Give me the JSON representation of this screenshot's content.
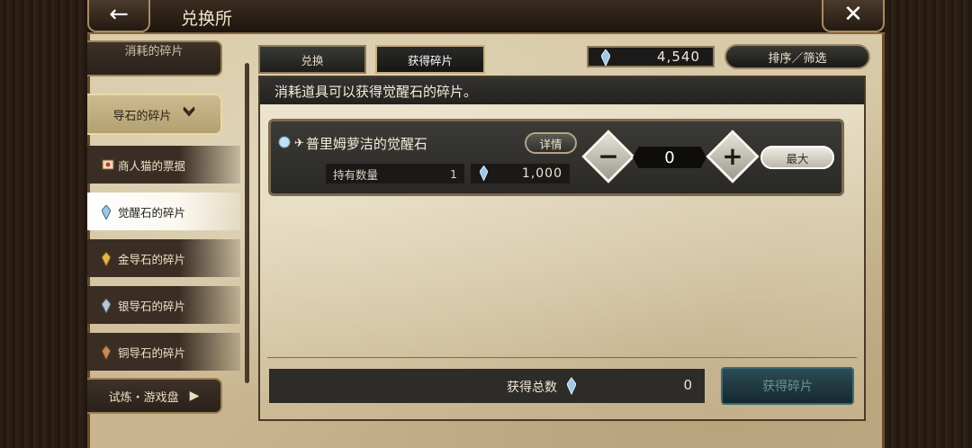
{
  "header": {
    "title": "兑换所",
    "back_icon": "back-arrow-icon",
    "close_icon": "close-icon"
  },
  "sidebar": {
    "partial_top_label": "消耗的碎片",
    "category_active": "导石的碎片",
    "subitems": [
      {
        "label": "商人猫的票据",
        "icon": "ticket-icon"
      },
      {
        "label": "觉醒石的碎片",
        "icon": "awakening-shard-icon"
      },
      {
        "label": "金导石的碎片",
        "icon": "gold-shard-icon"
      },
      {
        "label": "银导石的碎片",
        "icon": "silver-shard-icon"
      },
      {
        "label": "铜导石的碎片",
        "icon": "bronze-shard-icon"
      }
    ],
    "category_bottom": "试炼・游戏盘"
  },
  "tabs": [
    {
      "label": "兑换",
      "selected": false
    },
    {
      "label": "获得碎片",
      "selected": true
    }
  ],
  "currency": {
    "amount": "4,540",
    "icon": "awakening-shard-icon"
  },
  "sort_label": "排序／筛选",
  "panel_heading": "消耗道具可以获得觉醒石的碎片。",
  "item": {
    "name": "普里姆萝洁的觉醒石",
    "detail_label": "详情",
    "owned_label": "持有数量",
    "owned_count": "1",
    "cost": "1,000",
    "quantity": "0",
    "max_label": "最大"
  },
  "footer": {
    "total_label": "获得总数",
    "total_value": "0",
    "get_button": "获得碎片"
  },
  "colors": {
    "accent_gold": "#c4ac7b",
    "get_button_bg": "#2c4c56"
  }
}
